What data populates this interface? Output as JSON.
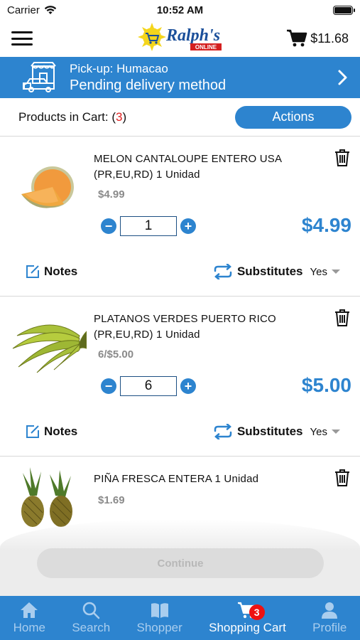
{
  "status_bar": {
    "carrier": "Carrier",
    "time": "10:52 AM"
  },
  "header": {
    "logo_text": "Ralph's",
    "logo_subtext": "ONLINE",
    "cart_total": "$11.68"
  },
  "pickup": {
    "line1": "Pick-up: Humacao",
    "line2": "Pending delivery method"
  },
  "cart": {
    "count_label": "Products in Cart: (",
    "count": "3",
    "count_close": ")",
    "actions_label": "Actions"
  },
  "products": [
    {
      "name": "MELON CANTALOUPE ENTERO USA (PR,EU,RD) 1 Unidad",
      "unit_price": "$4.99",
      "quantity": "1",
      "line_total": "$4.99",
      "notes_label": "Notes",
      "substitutes_label": "Substitutes",
      "substitutes_value": "Yes"
    },
    {
      "name": "PLATANOS VERDES PUERTO RICO (PR,EU,RD) 1 Unidad",
      "unit_price": "6/$5.00",
      "quantity": "6",
      "line_total": "$5.00",
      "notes_label": "Notes",
      "substitutes_label": "Substitutes",
      "substitutes_value": "Yes"
    },
    {
      "name": "PIÑA FRESCA ENTERA 1 Unidad",
      "unit_price": "$1.69"
    }
  ],
  "continue_label": "Continue",
  "tabs": [
    {
      "label": "Home",
      "icon": "home-icon"
    },
    {
      "label": "Search",
      "icon": "search-icon"
    },
    {
      "label": "Shopper",
      "icon": "book-icon"
    },
    {
      "label": "Shopping Cart",
      "icon": "cart-icon",
      "badge": "3",
      "active": true
    },
    {
      "label": "Profile",
      "icon": "profile-icon"
    }
  ],
  "colors": {
    "brand_blue": "#2d84cf",
    "badge_red": "#e11111",
    "count_red": "#e02020"
  }
}
